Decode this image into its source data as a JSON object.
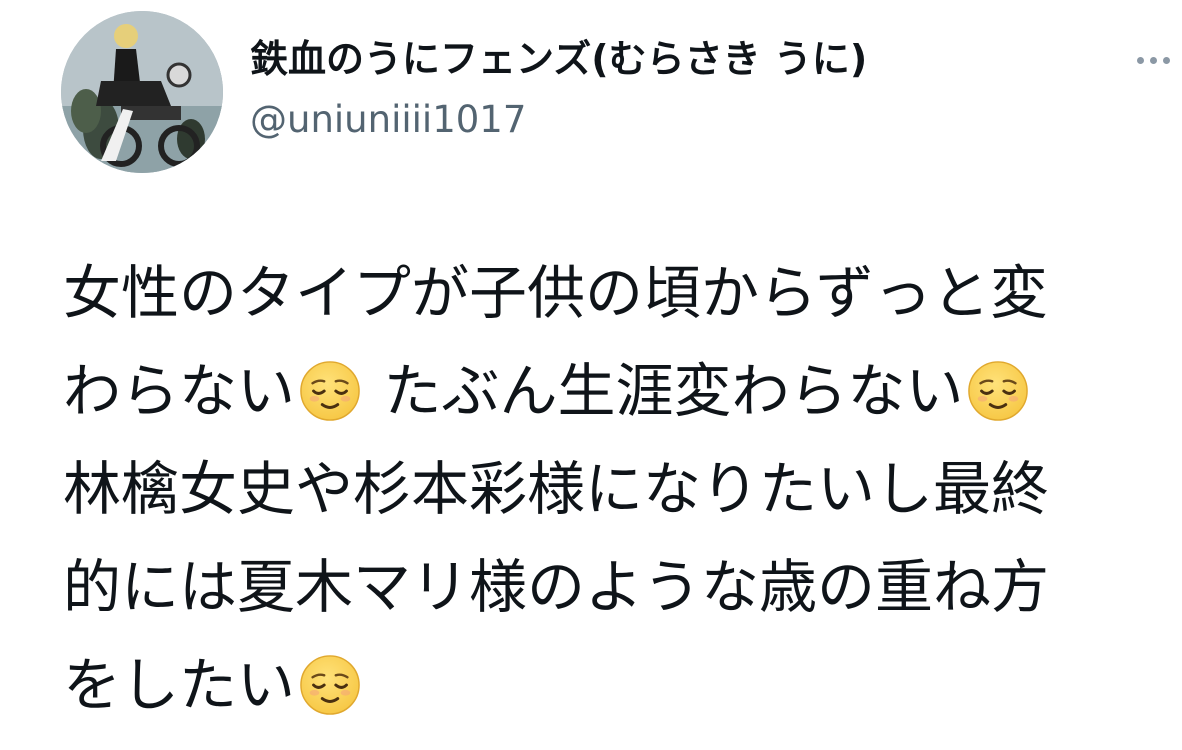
{
  "tweet": {
    "display_name": "鉄血のうにフェンズ(むらさき うに)",
    "handle": "@uniuniiii1017",
    "more_icon": "more-horizontal-icon",
    "lines": [
      {
        "segments": [
          "女性のタイプが子供の頃からずっと変"
        ]
      },
      {
        "segments": [
          "わらない",
          "relieved-face-emoji",
          " たぶん生涯変わらない",
          "relieved-face-emoji"
        ]
      },
      {
        "segments": [
          "林檎女史や杉本彩様になりたいし最終"
        ]
      },
      {
        "segments": [
          "的には夏木マリ様のような歳の重ね方"
        ]
      },
      {
        "segments": [
          "をしたい",
          "relieved-face-emoji"
        ]
      }
    ]
  },
  "colors": {
    "text": "#0f1419",
    "secondary_text": "#536471",
    "more_icon": "#8b98a5",
    "emoji_face": "#f7c948"
  }
}
